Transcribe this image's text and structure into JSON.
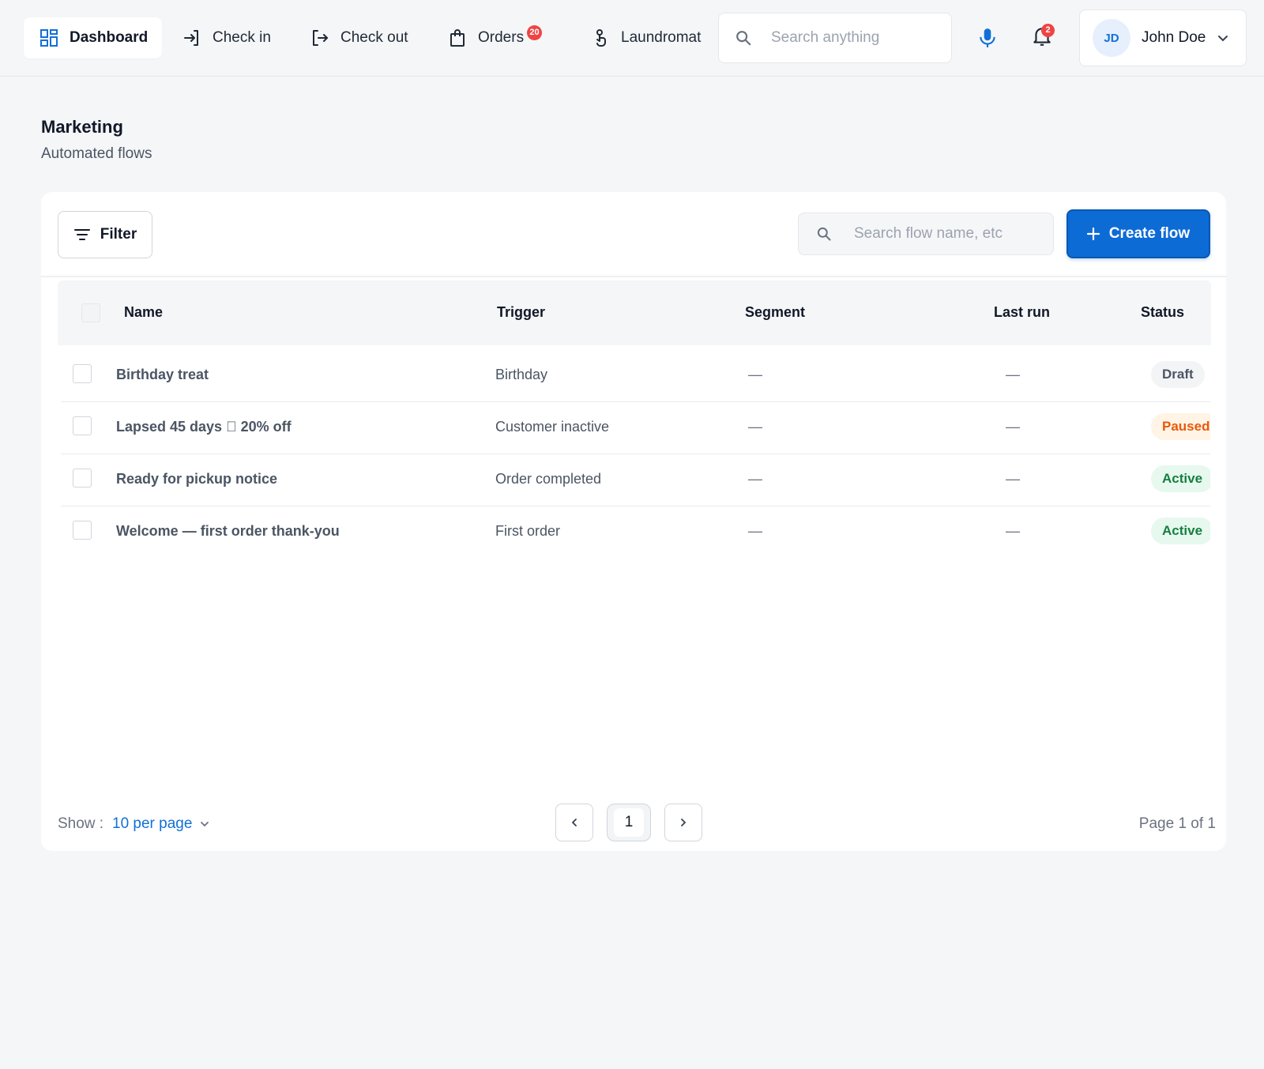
{
  "nav": {
    "items": [
      {
        "label": "Dashboard",
        "icon": "dashboard-grid-icon"
      },
      {
        "label": "Check in",
        "icon": "check-in-icon"
      },
      {
        "label": "Check out",
        "icon": "check-out-icon"
      },
      {
        "label": "Orders",
        "icon": "shopping-bag-icon",
        "badge": "20"
      },
      {
        "label": "Laundromat",
        "icon": "hand-tap-icon"
      }
    ],
    "search_placeholder": "Search anything",
    "notifications_badge": "2",
    "user": {
      "initials": "JD",
      "name": "John Doe"
    }
  },
  "page": {
    "title": "Marketing",
    "subtitle": "Automated flows"
  },
  "toolbar": {
    "filter_label": "Filter",
    "search_placeholder": "Search flow name, etc",
    "create_label": "Create flow"
  },
  "table": {
    "columns": [
      "Name",
      "Trigger",
      "Segment",
      "Last run",
      "Status"
    ],
    "rows": [
      {
        "name": "Birthday treat",
        "trigger": "Birthday",
        "segment": "—",
        "last_run": "—",
        "status": "Draft"
      },
      {
        "name": "Lapsed 45 days \u0000 20% off",
        "trigger": "Customer inactive",
        "segment": "—",
        "last_run": "—",
        "status": "Paused"
      },
      {
        "name": "Ready for pickup notice",
        "trigger": "Order completed",
        "segment": "—",
        "last_run": "—",
        "status": "Active"
      },
      {
        "name": "Welcome — first order thank-you",
        "trigger": "First order",
        "segment": "—",
        "last_run": "—",
        "status": "Active"
      }
    ]
  },
  "pagination": {
    "show_label": "Show :",
    "per_page": "10 per page",
    "current_page": "1",
    "page_info": "Page 1 of 1"
  },
  "colors": {
    "accent": "#0d6bd6",
    "badge": "#ef4444",
    "status_draft_bg": "#f3f4f6",
    "status_draft_fg": "#4b5563",
    "status_paused_bg": "#fff4e5",
    "status_paused_fg": "#e8590c",
    "status_active_bg": "#e7f8ef",
    "status_active_fg": "#15803d"
  }
}
